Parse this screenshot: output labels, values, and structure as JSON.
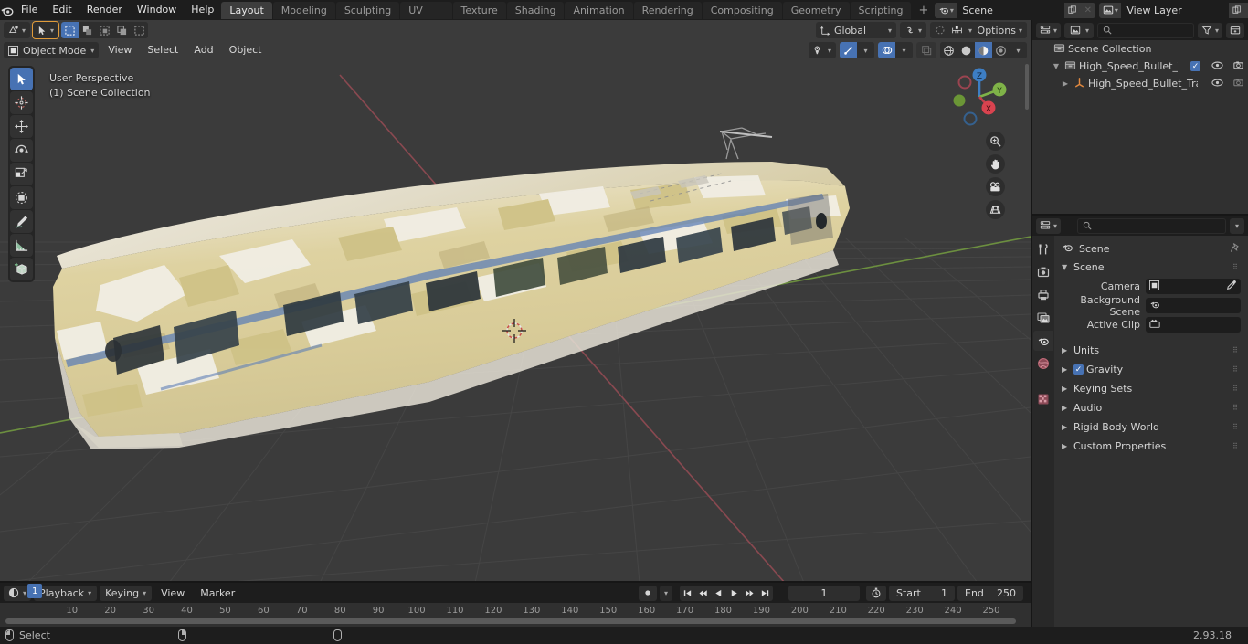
{
  "app": {
    "version": "2.93.18",
    "name": "Blender"
  },
  "topbar": {
    "menus": [
      "File",
      "Edit",
      "Render",
      "Window",
      "Help"
    ],
    "workspaces": [
      {
        "label": "Layout",
        "active": true
      },
      {
        "label": "Modeling",
        "active": false
      },
      {
        "label": "Sculpting",
        "active": false
      },
      {
        "label": "UV Editing",
        "active": false
      },
      {
        "label": "Texture Paint",
        "active": false
      },
      {
        "label": "Shading",
        "active": false
      },
      {
        "label": "Animation",
        "active": false
      },
      {
        "label": "Rendering",
        "active": false
      },
      {
        "label": "Compositing",
        "active": false
      },
      {
        "label": "Geometry Nodes",
        "active": false
      },
      {
        "label": "Scripting",
        "active": false
      }
    ],
    "add_workspace": "+",
    "scene": {
      "name": "Scene",
      "icon": "scene-icon",
      "copy": "copy-icon",
      "unlink": "x-icon"
    },
    "view_layer": {
      "name": "View Layer",
      "icon": "viewlayer-icon",
      "copy": "copy-icon",
      "unlink": "x-icon"
    }
  },
  "viewport": {
    "mode": "Object Mode",
    "menus": [
      "View",
      "Select",
      "Add",
      "Object"
    ],
    "transform_orientation": "Global",
    "options_label": "Options",
    "overlay_text": {
      "line1": "User Perspective",
      "line2": "(1) Scene Collection"
    },
    "gizmo_axes": {
      "z": "Z",
      "y": "Y",
      "x": "X"
    },
    "tools": [
      {
        "name": "tweak-select-tool",
        "active": true
      },
      {
        "name": "cursor-tool",
        "active": false
      },
      {
        "name": "move-tool",
        "active": false
      },
      {
        "name": "rotate-tool",
        "active": false
      },
      {
        "name": "scale-tool",
        "active": false
      },
      {
        "name": "transform-tool",
        "active": false
      },
      {
        "name": "annotate-tool",
        "active": false
      },
      {
        "name": "measure-tool",
        "active": false
      },
      {
        "name": "add-cube-tool",
        "active": false
      }
    ],
    "shading_modes": [
      "wireframe",
      "solid",
      "material-preview",
      "rendered"
    ],
    "shading_active": "material-preview",
    "nav_buttons": [
      "zoom-icon",
      "pan-hand-icon",
      "camera-icon",
      "grid-ortho-icon"
    ]
  },
  "outliner": {
    "display_mode": "View Layer",
    "search_placeholder": "",
    "rows": [
      {
        "indent": 0,
        "disclosure": "",
        "icon": "collection-icon",
        "label": "Scene Collection",
        "checkbox": false,
        "eye": false,
        "camera": false,
        "selected": false
      },
      {
        "indent": 1,
        "disclosure": "▼",
        "icon": "collection-icon",
        "label": "High_Speed_Bullet_Train_Wa…",
        "checkbox": true,
        "eye": true,
        "camera": true,
        "selected": false
      },
      {
        "indent": 2,
        "disclosure": "▶",
        "icon": "object-icon",
        "label": "High_Speed_Bullet_Train…",
        "checkbox": false,
        "eye": true,
        "camera": true,
        "selected": false
      }
    ]
  },
  "properties": {
    "tabs": [
      {
        "name": "tool-tab",
        "active": false
      },
      {
        "name": "render-tab",
        "active": false
      },
      {
        "name": "output-tab",
        "active": false
      },
      {
        "name": "view-layer-tab",
        "active": false
      },
      {
        "name": "scene-tab",
        "active": true
      },
      {
        "name": "world-tab",
        "active": false
      },
      {
        "name": "texture-tab",
        "active": false
      }
    ],
    "breadcrumb": "Scene",
    "pin_icon": "pin-icon",
    "panel_title": "Scene",
    "fields": [
      {
        "label": "Camera",
        "value": "",
        "icon": "camera-data-icon",
        "eyedropper": true
      },
      {
        "label": "Background Scene",
        "value": "",
        "icon": "scene-icon",
        "eyedropper": false
      },
      {
        "label": "Active Clip",
        "value": "",
        "icon": "clip-icon",
        "eyedropper": false
      }
    ],
    "sub_panels": [
      {
        "label": "Units",
        "checkbox": false
      },
      {
        "label": "Gravity",
        "checkbox": true
      },
      {
        "label": "Keying Sets",
        "checkbox": false
      },
      {
        "label": "Audio",
        "checkbox": false
      },
      {
        "label": "Rigid Body World",
        "checkbox": false
      },
      {
        "label": "Custom Properties",
        "checkbox": false
      }
    ]
  },
  "timeline": {
    "editor_type": "timeline-icon",
    "menus": [
      "Playback",
      "Keying",
      "View",
      "Marker"
    ],
    "current_frame": "1",
    "start_label": "Start",
    "start_value": "1",
    "end_label": "End",
    "end_value": "250",
    "playhead_label": "1",
    "ticks": [
      10,
      20,
      30,
      40,
      50,
      60,
      70,
      80,
      90,
      100,
      110,
      120,
      130,
      140,
      150,
      160,
      170,
      180,
      190,
      200,
      210,
      220,
      230,
      240,
      250
    ],
    "transport": [
      "jump-start-icon",
      "prev-keyframe-icon",
      "play-reverse-icon",
      "play-icon",
      "next-keyframe-icon",
      "jump-end-icon"
    ],
    "record_icon": "record-icon"
  },
  "status": {
    "left_items": [
      {
        "icon": "mouse-left-icon",
        "label": "Select"
      },
      {
        "icon": "mouse-middle-icon",
        "label": ""
      },
      {
        "icon": "mouse-right-icon",
        "label": ""
      }
    ],
    "version": "2.93.18"
  },
  "colors": {
    "accent": "#4772b3",
    "bg_dark": "#1d1d1d",
    "bg_panel": "#303030",
    "viewport_bg": "#3b3b3b",
    "axis_x": "#bb4b4b",
    "axis_y": "#7fb348",
    "train_body": "#ddd3a4",
    "train_light": "#e8e8e0"
  }
}
